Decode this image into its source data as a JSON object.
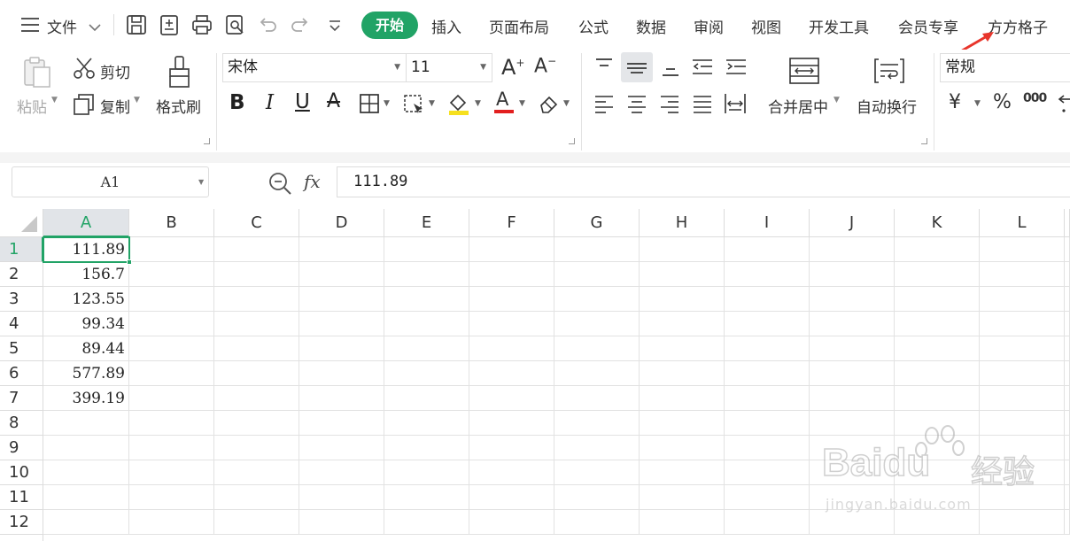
{
  "menu": {
    "file": "文件",
    "tabs": [
      "开始",
      "插入",
      "页面布局",
      "公式",
      "数据",
      "审阅",
      "视图",
      "开发工具",
      "会员专享",
      "方方格子"
    ]
  },
  "colors": {
    "accent": "#21a366",
    "arrow": "#e8352b"
  },
  "ribbon": {
    "paste": "粘贴",
    "cut": "剪切",
    "copy": "复制",
    "format_painter": "格式刷",
    "font_name": "宋体",
    "font_size": "11",
    "bold": "B",
    "italic": "I",
    "underline": "U",
    "strike": "A",
    "font_color_letter": "A",
    "grow_font": "A",
    "shrink_font": "A",
    "merge_center": "合并居中",
    "wrap_text": "自动换行",
    "number_format": "常规",
    "currency": "¥",
    "percent": "%",
    "thousands": "000"
  },
  "formula_bar": {
    "name_box": "A1",
    "fx": "fx",
    "value": "111.89"
  },
  "sheet": {
    "columns": [
      "A",
      "B",
      "C",
      "D",
      "E",
      "F",
      "G",
      "H",
      "I",
      "J",
      "K",
      "L"
    ],
    "rows": [
      "1",
      "2",
      "3",
      "4",
      "5",
      "6",
      "7",
      "8",
      "9",
      "10",
      "11",
      "12"
    ],
    "col_a_values": [
      "111.89",
      "156.7",
      "123.55",
      "99.34",
      "89.44",
      "577.89",
      "399.19"
    ],
    "selected_cell": "A1"
  },
  "watermark": {
    "brand": "Baidu",
    "cn": "经验",
    "url": "jingyan.baidu.com"
  }
}
